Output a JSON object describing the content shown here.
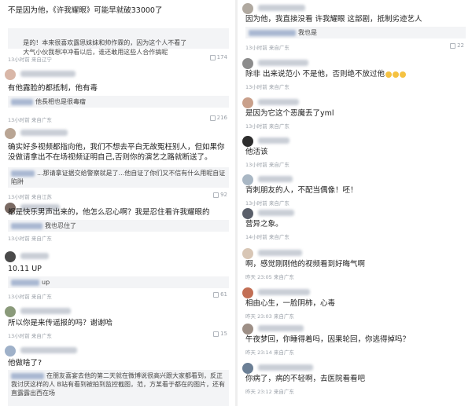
{
  "left": {
    "comments": [
      {
        "text": "不是因为他，《许我耀眼》可能早就破33000了",
        "reply": "",
        "meta": "",
        "likes": ""
      },
      {
        "text": "是的！本来很喜欢露思妹妹和帅作霖的，因为这个人不看了",
        "reply": "大气小伙我想冲冲看以后，谁还敢用这些人合作搞呢",
        "meta": "13小时前 来自辽宁",
        "likes": "174"
      },
      {
        "text": "有他露脸的都抵制，他有毒",
        "reply": "他長相也是很毒瘤",
        "meta": "13小时前 来自广东",
        "likes": "216"
      },
      {
        "text": "确实好多视频都指向他，我们不想去平白无故冤枉别人，但如果你没做请拿出不在场视频证明自己,否则你的演艺之路就断送了。",
        "reply": "...那请拿证据交给警察就是了...他自证了你们又不信有什么用呢自证陷阱",
        "meta": "13小时前 来自江苏",
        "likes": "92"
      },
      {
        "text": "都是快乐男声出来的，他怎么忍心啊？我是忍住看许我耀眼的",
        "reply": "我也忍住了",
        "meta": "13小时前 来自广东",
        "likes": ""
      },
      {
        "text": "10.11 UP",
        "reply": "up",
        "meta": "13小时前 来自广东",
        "likes": "61"
      },
      {
        "text": "所以你是来传谣报的吗？谢谢哈",
        "reply": "",
        "meta": "13小时前 来自广东",
        "likes": "15"
      },
      {
        "text": "他做啥了?",
        "reply": "在朋友喜宴去他的第二天就在微博说很高兴跟大家都看到，反正我讨厌这样的人 B站有看到被拍到监控截图，范，方某看于都在的图片，还有直露露出西在场",
        "meta": "",
        "likes": ""
      }
    ]
  },
  "right": {
    "comments": [
      {
        "text": "因为他，我直接没看 许我耀眼 这部剧，抵制劣迹艺人",
        "reply": "我也是",
        "meta": "13小时前 来自广东",
        "likes": "22"
      },
      {
        "text": "除非 出来说范小 不是他，否则绝不放过他",
        "reply": "",
        "meta": "13小时前 来自广东",
        "likes": ""
      },
      {
        "text": "是因为它这个恶魔丢了yml",
        "reply": "",
        "meta": "13小时前 来自广东",
        "likes": ""
      },
      {
        "text": "他活该",
        "reply": "",
        "meta": "13小时前 来自广东",
        "likes": ""
      },
      {
        "text": "背刺朋友的人，不配当偶像！呸！",
        "reply": "",
        "meta": "13小时前 来自广东",
        "likes": ""
      },
      {
        "text": "营异之象。",
        "reply": "",
        "meta": "14小时前 来自广东",
        "likes": ""
      },
      {
        "text": "啊，感觉刚刚他的视频看到好晦气啊",
        "reply": "",
        "meta": "昨天 23:05 来自广东",
        "likes": ""
      },
      {
        "text": "相由心生，一脸阴柿，心毒",
        "reply": "",
        "meta": "昨天 23:03 来自广东",
        "likes": ""
      },
      {
        "text": "午夜梦回，你睡得着吗，因果轮回，你逃得掉吗？",
        "reply": "",
        "meta": "昨天 23:14 来自广东",
        "likes": ""
      },
      {
        "text": "你病了，病的不轻啊，去医院看看吧",
        "reply": "",
        "meta": "昨天 23:12 来自广东",
        "likes": ""
      }
    ]
  },
  "colors": {
    "accent": "#1e6fc8",
    "meta": "#9aa0a8",
    "reply_bg": "#f3f4f6"
  },
  "icons": {
    "like": "thumb-up-icon"
  }
}
